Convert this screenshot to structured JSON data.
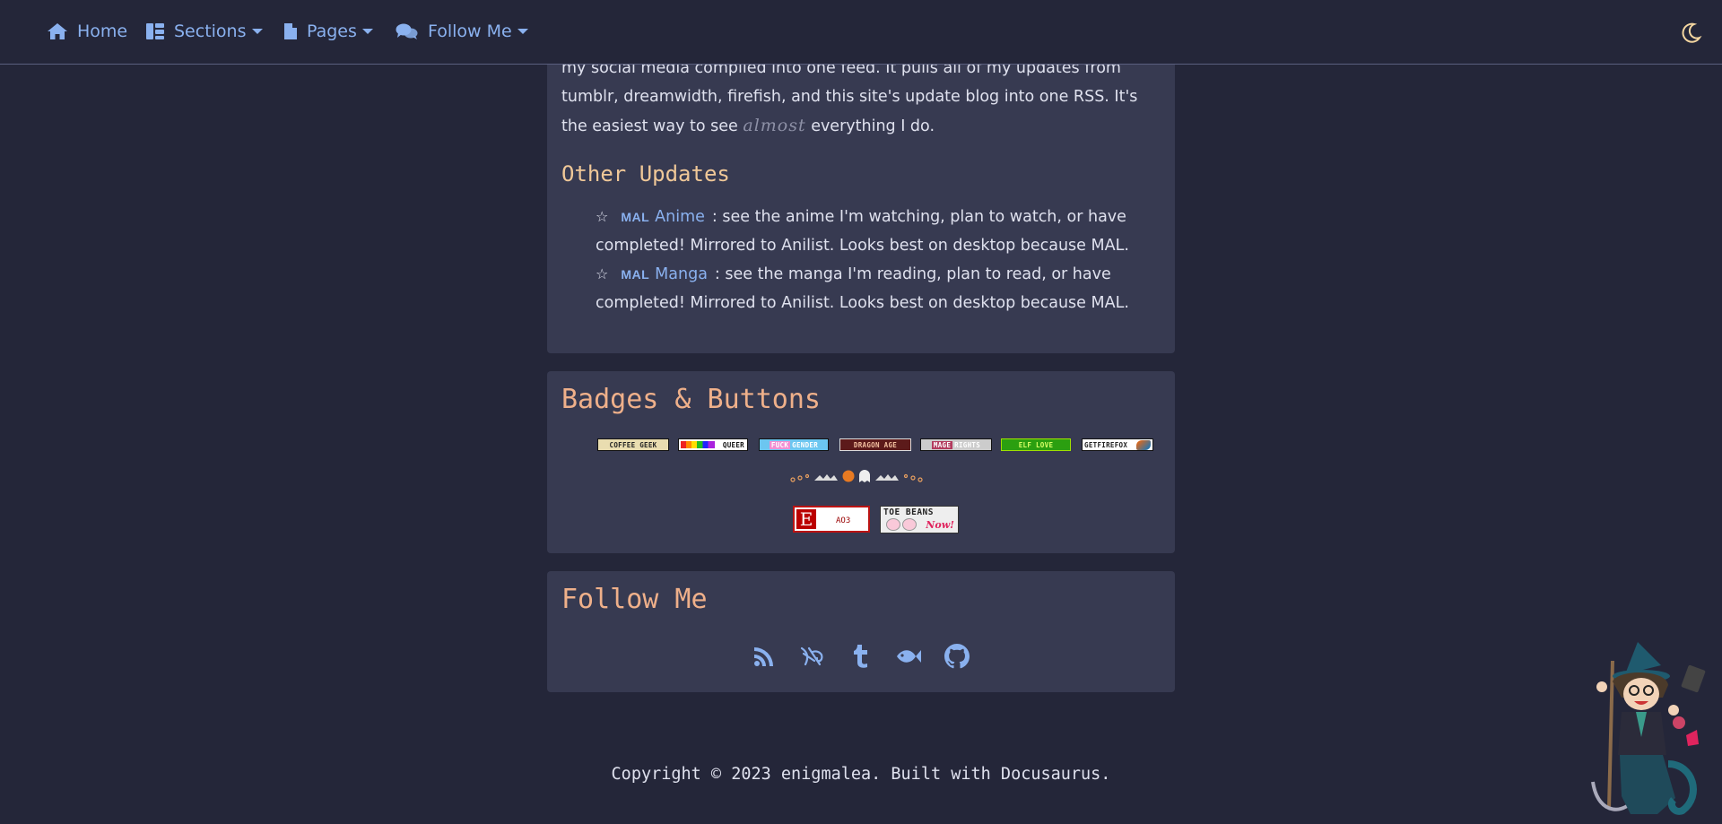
{
  "nav": {
    "home": "Home",
    "sections": "Sections",
    "pages": "Pages",
    "follow": "Follow Me"
  },
  "intro": {
    "text_before": "my social media compiled into one feed. It pulls all of my updates from tumblr, dreamwidth, firefish, and this site's update blog into one RSS. It's the easiest way to see ",
    "emphasis": "almost",
    "text_after": " everything I do."
  },
  "other_updates": {
    "title": "Other Updates",
    "items": [
      {
        "star": "☆",
        "mal": "MAL",
        "link": "Anime",
        "desc": ": see the anime I'm watching, plan to watch, or have completed! Mirrored to Anilist. Looks best on desktop because MAL."
      },
      {
        "star": "☆",
        "mal": "MAL",
        "link": "Manga",
        "desc": ": see the manga I'm reading, plan to read, or have completed! Mirrored to Anilist. Looks best on desktop because MAL."
      }
    ]
  },
  "badges": {
    "title": "Badges & Buttons",
    "coffee": "COFFEE GEEK",
    "queer": "QUEER",
    "fuck_gender_a": "FUCK",
    "fuck_gender_b": "GENDER",
    "dragon_age": "DRAGON AGE",
    "mage_a": "MAGE",
    "mage_b": "RIGHTS",
    "elf_love": "ELF    LOVE",
    "firefox": "GETFIREFOX",
    "ao3_letter": "E",
    "ao3": "AO3",
    "toe_beans": "TOE BEANS",
    "toe_now": "Now!"
  },
  "follow": {
    "title": "Follow Me",
    "icons": [
      "rss-icon",
      "dreamwidth-icon",
      "tumblr-icon",
      "fish-icon",
      "github-icon"
    ]
  },
  "footer": "Copyright © 2023 enigmalea. Built with Docusaurus.",
  "colors": {
    "background": "#242639",
    "card": "#373a51",
    "link": "#8ab1ef",
    "heading": "#efb08a"
  }
}
